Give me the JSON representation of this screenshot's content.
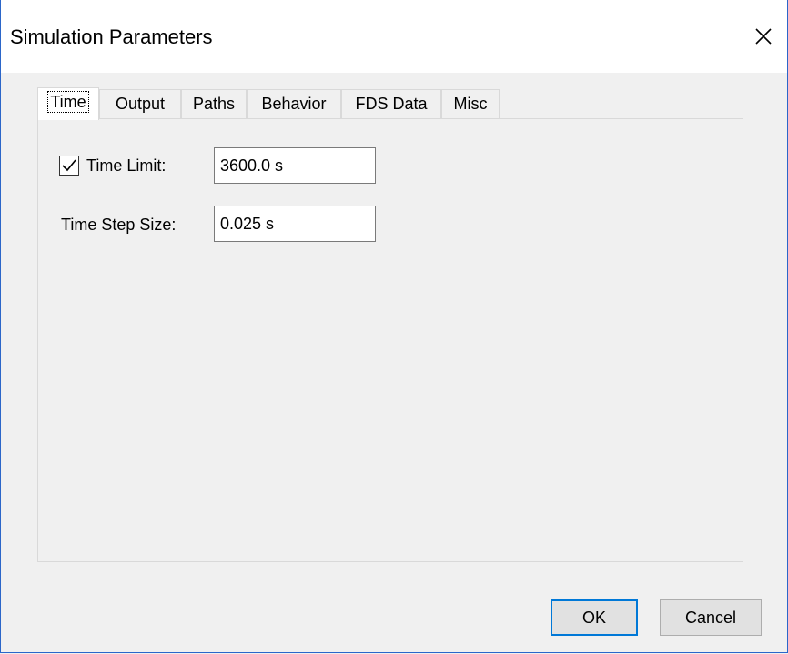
{
  "window": {
    "title": "Simulation Parameters",
    "close_icon": "close-icon"
  },
  "tabs": [
    {
      "label": "Time",
      "active": true
    },
    {
      "label": "Output",
      "active": false
    },
    {
      "label": "Paths",
      "active": false
    },
    {
      "label": "Behavior",
      "active": false
    },
    {
      "label": "FDS Data",
      "active": false
    },
    {
      "label": "Misc",
      "active": false
    }
  ],
  "time_panel": {
    "time_limit": {
      "checked": true,
      "label": "Time Limit:",
      "value": "3600.0 s"
    },
    "time_step_size": {
      "label": "Time Step Size:",
      "value": "0.025 s"
    }
  },
  "buttons": {
    "ok_label": "OK",
    "cancel_label": "Cancel"
  },
  "colors": {
    "window_border": "#2b66c9",
    "default_button_border": "#0078d7",
    "dialog_background": "#f0f0f0"
  }
}
